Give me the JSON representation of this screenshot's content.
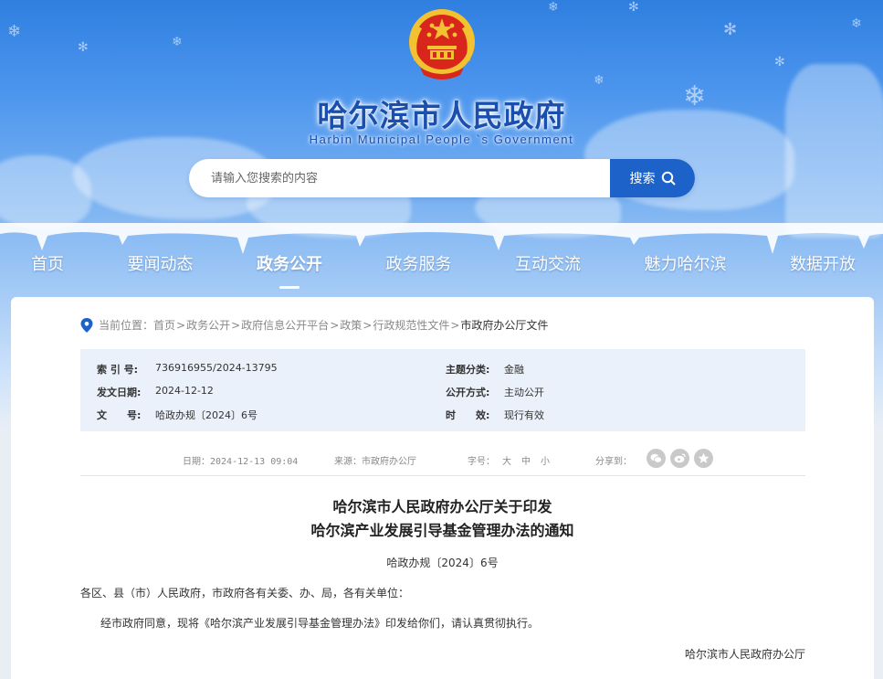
{
  "header": {
    "title": "哈尔滨市人民政府",
    "subtitle": "Harbin Municipal People `s Government"
  },
  "search": {
    "placeholder": "请输入您搜索的内容",
    "button_label": "搜索"
  },
  "nav": {
    "items": [
      "首页",
      "要闻动态",
      "政务公开",
      "政务服务",
      "互动交流",
      "魅力哈尔滨",
      "数据开放"
    ],
    "active": "政务公开"
  },
  "breadcrumb": {
    "prefix": "当前位置：",
    "items": [
      "首页",
      "政务公开",
      "政府信息公开平台",
      "政策",
      "行政规范性文件",
      "市政府办公厅文件"
    ],
    "separator": ">"
  },
  "meta": {
    "index_label": "索 引 号:",
    "index_value": "736916955/2024-13795",
    "category_label": "主题分类:",
    "category_value": "金融",
    "date_label": "发文日期:",
    "date_value": "2024-12-12",
    "publish_label": "公开方式:",
    "publish_value": "主动公开",
    "docno_label": "文　　号:",
    "docno_value": "哈政办规〔2024〕6号",
    "validity_label": "时　　效:",
    "validity_value": "现行有效"
  },
  "infobar": {
    "date": "日期：2024-12-13 09:04",
    "source": "来源：市政府办公厅",
    "font_label": "字号：",
    "font_sizes": [
      "大",
      "中",
      "小"
    ],
    "share_label": "分享到："
  },
  "document": {
    "title_line1": "哈尔滨市人民政府办公厅关于印发",
    "title_line2": "哈尔滨产业发展引导基金管理办法的通知",
    "number": "哈政办规〔2024〕6号",
    "salutation": "各区、县（市）人民政府，市政府各有关委、办、局，各有关单位：",
    "body": "经市政府同意，现将《哈尔滨产业发展引导基金管理办法》印发给你们，请认真贯彻执行。",
    "signature": "哈尔滨市人民政府办公厅"
  },
  "colors": {
    "brand_blue": "#1d62c9",
    "title_blue": "#1b4fae",
    "meta_bg": "#eaf1fa",
    "emblem_red": "#d8261c",
    "emblem_gold": "#f2c230"
  },
  "icons": {
    "search": "search-icon",
    "location": "location-pin-icon",
    "share": [
      "wechat-icon",
      "weibo-icon",
      "favorite-icon"
    ]
  }
}
